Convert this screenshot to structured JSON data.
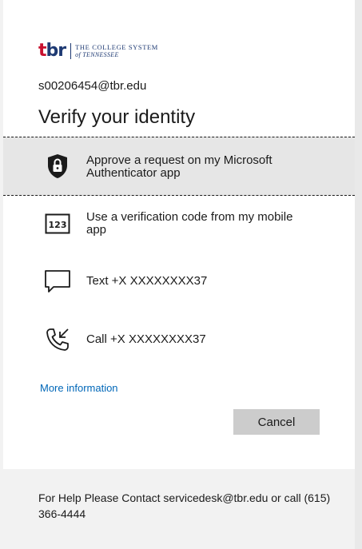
{
  "branding": {
    "logo_mark_t": "t",
    "logo_mark_br": "br",
    "logo_line1": "THE COLLEGE SYSTEM",
    "logo_line2": "of TENNESSEE",
    "brand_red": "#c8102e",
    "brand_blue": "#1e3a73"
  },
  "account": {
    "email": "s00206454@tbr.edu"
  },
  "page": {
    "title": "Verify your identity"
  },
  "options": [
    {
      "label": "Approve a request on my Microsoft Authenticator app",
      "icon": "lock-shield-icon",
      "selected": true
    },
    {
      "label": "Use a verification code from my mobile app",
      "icon": "code-123-icon",
      "icon_text": "123",
      "selected": false
    },
    {
      "label": "Text +X XXXXXXXX37",
      "icon": "message-icon",
      "selected": false
    },
    {
      "label": "Call +X XXXXXXXX37",
      "icon": "phone-call-icon",
      "selected": false
    }
  ],
  "links": {
    "more_info": "More information"
  },
  "buttons": {
    "cancel": "Cancel"
  },
  "footer": {
    "help_text": "For Help Please Contact servicedesk@tbr.edu or call (615) 366-4444"
  },
  "colors": {
    "link": "#0067b8",
    "selected_bg": "#e6e6e6",
    "button_bg": "#cccccc"
  }
}
